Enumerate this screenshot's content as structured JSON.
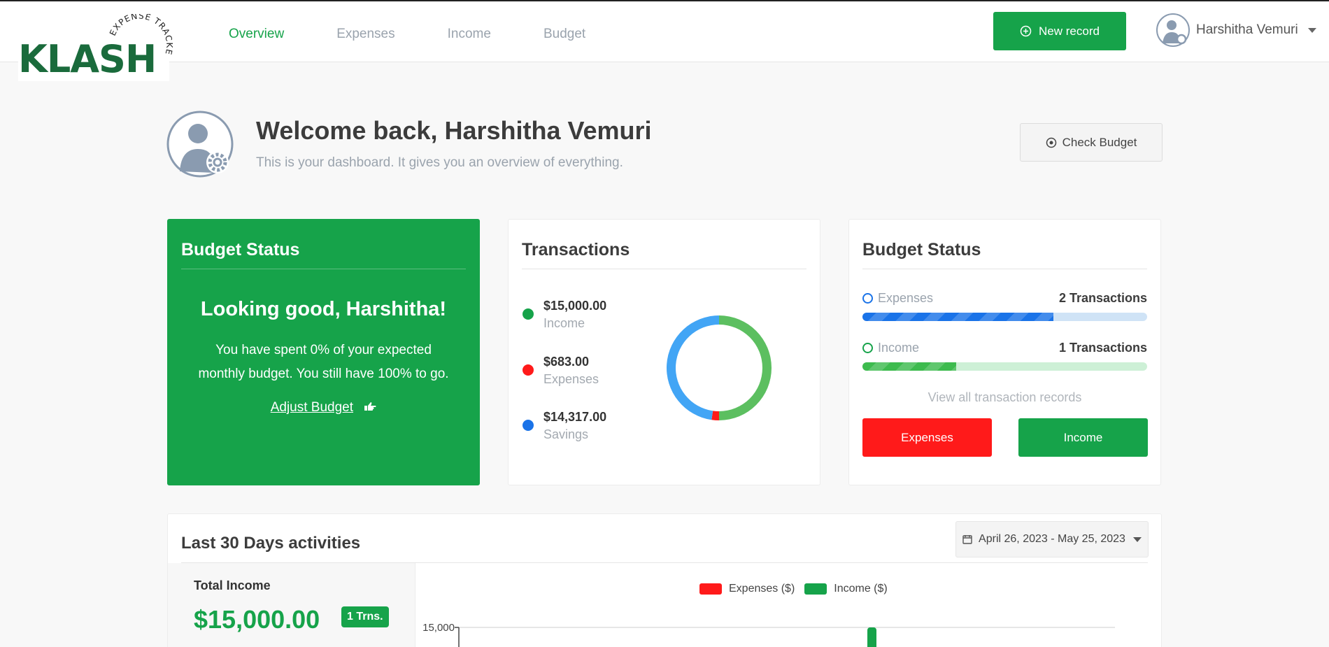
{
  "nav": {
    "logo": {
      "word": "KLASH",
      "tagline": "EXPENSE TRACKER"
    },
    "links": [
      {
        "label": "Overview",
        "active": true
      },
      {
        "label": "Expenses",
        "active": false
      },
      {
        "label": "Income",
        "active": false
      },
      {
        "label": "Budget",
        "active": false
      }
    ],
    "new_record": "New record",
    "user_name": "Harshitha Vemuri"
  },
  "welcome": {
    "title": "Welcome back, Harshitha Vemuri",
    "subtitle": "This is your dashboard. It gives you an overview of everything.",
    "check_budget": "Check Budget"
  },
  "budget_card": {
    "title": "Budget Status",
    "headline": "Looking good, Harshitha!",
    "body": "You have spent 0% of your expected monthly budget. You still have 100% to go.",
    "adjust": "Adjust Budget"
  },
  "transactions_card": {
    "title": "Transactions",
    "items": [
      {
        "amount": "$15,000.00",
        "label": "Income",
        "color": "#16a34a"
      },
      {
        "amount": "$683.00",
        "label": "Expenses",
        "color": "#ff1a1a"
      },
      {
        "amount": "$14,317.00",
        "label": "Savings",
        "color": "#1a73e8"
      }
    ]
  },
  "chart_data": {
    "type": "pie",
    "donut": true,
    "categories": [
      "Income",
      "Expenses",
      "Savings"
    ],
    "values": [
      15000,
      683,
      14317
    ],
    "colors": [
      "#5cbf60",
      "#ff1a1a",
      "#42a5f5"
    ]
  },
  "status_card": {
    "title": "Budget Status",
    "expenses": {
      "label": "Expenses",
      "count": "2 Transactions",
      "progress": 0.67,
      "color": "#1a73e8",
      "track": "#cfe3f6"
    },
    "income": {
      "label": "Income",
      "count": "1 Transactions",
      "progress": 0.33,
      "color": "#3dbb4e",
      "track": "#cdf0d6"
    },
    "view_all": "View all transaction records",
    "btn_expenses": "Expenses",
    "btn_income": "Income"
  },
  "activity": {
    "title": "Last 30 Days activities",
    "date_range": "April 26, 2023 - May 25, 2023",
    "total_income_label": "Total Income",
    "total_income": "$15,000.00",
    "badge": "1 Trns.",
    "legend": [
      {
        "name": "Expenses ($)",
        "color": "#ff1a1a"
      },
      {
        "name": "Income ($)",
        "color": "#16a34a"
      }
    ],
    "y_tick": "15,000"
  }
}
